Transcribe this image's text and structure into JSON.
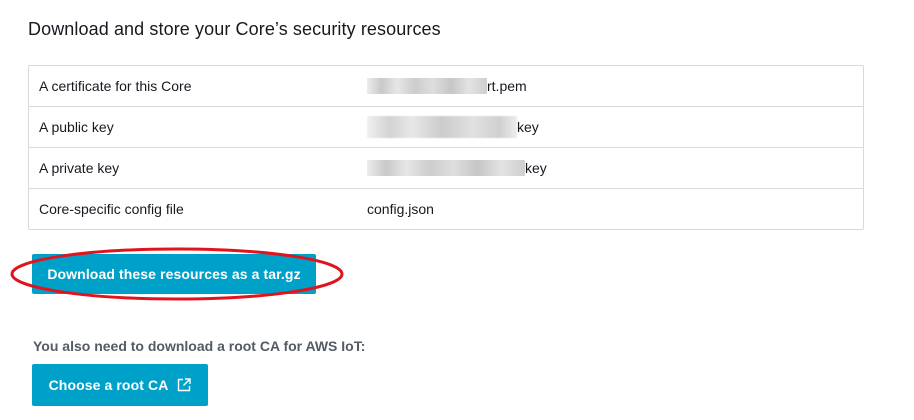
{
  "section": {
    "title": "Download and store your Core’s security resources"
  },
  "resources": [
    {
      "label": "A certificate for this Core",
      "value_suffix": "rt.pem",
      "redacted": true
    },
    {
      "label": "A public key",
      "value_suffix": "key",
      "redacted": true
    },
    {
      "label": "A private key",
      "value_suffix": "key",
      "redacted": true
    },
    {
      "label": "Core-specific config file",
      "value_suffix": "config.json",
      "redacted": false
    }
  ],
  "download_button": {
    "label": "Download these resources as a tar.gz"
  },
  "root_ca": {
    "note": "You also need to download a root CA for AWS IoT:",
    "button_label": "Choose a root CA",
    "button_icon": "external-link-icon"
  },
  "colors": {
    "primary_button": "#00a1c9",
    "annotation_oval": "#e0141e",
    "table_border": "#d5dbdb"
  }
}
